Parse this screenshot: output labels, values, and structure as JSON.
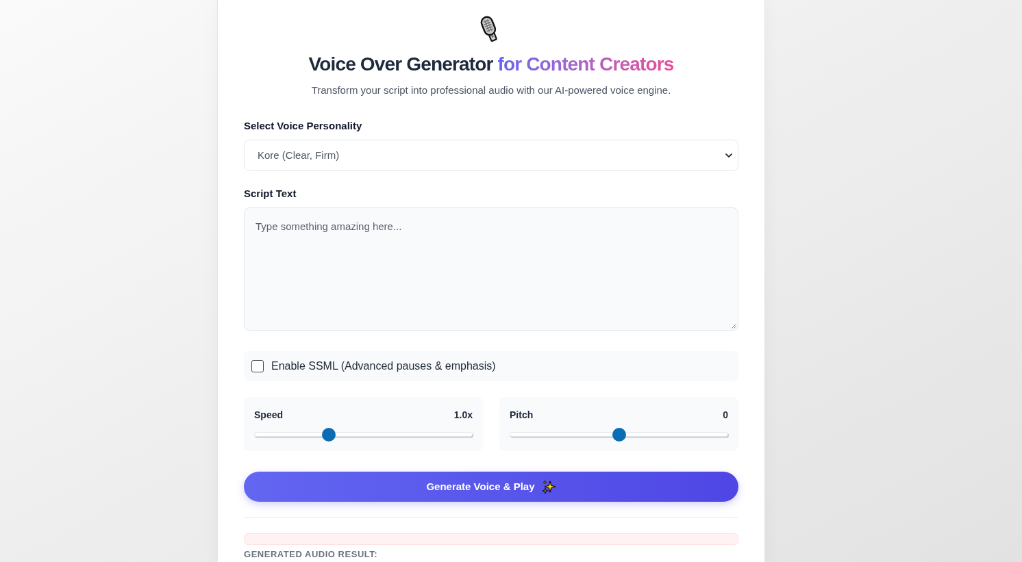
{
  "header": {
    "title": {
      "main": "Voice Over Generator",
      "highlight": "for Content Creators"
    },
    "subtitle": "Transform your script into professional audio with our AI-powered voice engine."
  },
  "voice": {
    "label": "Select Voice Personality",
    "value": "Kore (Clear, Firm)"
  },
  "script": {
    "label": "Script Text",
    "placeholder": "Type something amazing here..."
  },
  "ssml": {
    "label": "Enable SSML (Advanced pauses & emphasis)",
    "checked": false
  },
  "sliders": [
    {
      "label": "Speed",
      "reading": "1.0x",
      "level": 0.34
    },
    {
      "label": "Pitch",
      "reading": "0",
      "level": 0.5
    }
  ],
  "generate_button": {
    "label": "Generate Voice & Play"
  },
  "result": {
    "heading": "GENERATED AUDIO RESULT:"
  }
}
